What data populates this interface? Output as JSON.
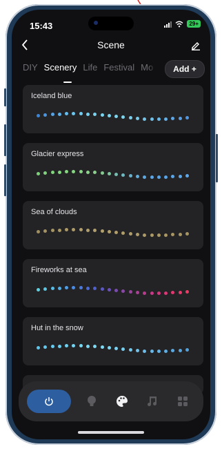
{
  "status_bar": {
    "time": "15:43",
    "battery": "29+"
  },
  "header": {
    "title": "Scene",
    "back_icon": "chevron-left-icon",
    "edit_icon": "pencil-icon"
  },
  "tabs": [
    {
      "label": "DIY",
      "active": false
    },
    {
      "label": "Scenery",
      "active": true
    },
    {
      "label": "Life",
      "active": false
    },
    {
      "label": "Festival",
      "active": false
    },
    {
      "label": "Mo",
      "active": false
    }
  ],
  "add_button": {
    "label": "Add +"
  },
  "scenes": [
    {
      "name": "Iceland blue",
      "colors": [
        "#3b86d6",
        "#4a95e0",
        "#57a3e6",
        "#5fb0ea",
        "#66bdee",
        "#6cc7ef",
        "#70ccf0",
        "#74d0f0",
        "#78d2f0",
        "#7cd4f0",
        "#7fd5ee",
        "#80d5ec",
        "#7fd2eb",
        "#7bcdea",
        "#78c9e9",
        "#74c4e8",
        "#70bfe7",
        "#6bb8e6",
        "#65b0e5",
        "#5ea7e4",
        "#589fe3",
        "#5197e2"
      ]
    },
    {
      "name": "Glacier express",
      "colors": [
        "#7fd07a",
        "#80d37c",
        "#82d57e",
        "#84d680",
        "#86d682",
        "#88d684",
        "#8ad686",
        "#8bd488",
        "#8ad08c",
        "#86ca92",
        "#80c4a0",
        "#78bdb0",
        "#70b7c0",
        "#68b1cf",
        "#62acdb",
        "#5ea8e2",
        "#5ca6e5",
        "#5ba5e6",
        "#5ba5e7",
        "#5ba6e8",
        "#5ca7e9",
        "#5da8ea"
      ]
    },
    {
      "name": "Sea of clouds",
      "colors": [
        "#a08f5f",
        "#a39262",
        "#a69564",
        "#a99866",
        "#ac9b68",
        "#ae9d6a",
        "#b09f6c",
        "#b1a06d",
        "#b2a16e",
        "#b2a16e",
        "#b1a06d",
        "#b09f6c",
        "#af9e6b",
        "#ae9d6a",
        "#ad9c69",
        "#ac9b68",
        "#ab9a67",
        "#aa9966",
        "#a99865",
        "#a89764",
        "#a79663",
        "#a69562"
      ]
    },
    {
      "name": "Fireworks at sea",
      "colors": [
        "#5fd0e0",
        "#5cc6e2",
        "#58bce4",
        "#54aee6",
        "#509ee6",
        "#4c8ce4",
        "#4a7ade",
        "#4a6ad6",
        "#5060cc",
        "#5c58c2",
        "#6a52b8",
        "#7a4cae",
        "#8a48a6",
        "#9a449e",
        "#aa4096",
        "#b83c8e",
        "#c63a86",
        "#d2387e",
        "#dc3878",
        "#e43872",
        "#e83a6c",
        "#ec3c66"
      ]
    },
    {
      "name": "Hut in the snow",
      "colors": [
        "#5ec4ea",
        "#62c8ec",
        "#66ccee",
        "#6acff0",
        "#6ed2f1",
        "#72d5f2",
        "#76d7f3",
        "#7ad8f3",
        "#7ed9f3",
        "#80d9f2",
        "#7fd6f1",
        "#7cd2f0",
        "#78cdee",
        "#74c7ec",
        "#70c2ea",
        "#6cbce8",
        "#68b7e6",
        "#64b2e4",
        "#60ade2",
        "#5ca9e0",
        "#58a5de",
        "#54a2dc"
      ]
    }
  ],
  "bottom_bar": {
    "items": [
      {
        "name": "power",
        "icon": "power-icon"
      },
      {
        "name": "lightbulb",
        "icon": "lightbulb-icon"
      },
      {
        "name": "palette",
        "icon": "palette-icon"
      },
      {
        "name": "music",
        "icon": "music-note-icon"
      },
      {
        "name": "grid",
        "icon": "grid-icon"
      }
    ]
  },
  "colors": {
    "accent": "#2d5ea0",
    "annotation_arrow": "#e02020"
  }
}
